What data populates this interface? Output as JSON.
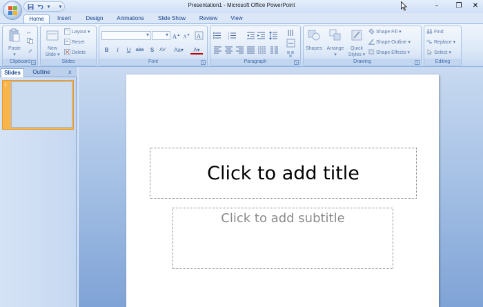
{
  "window": {
    "title": "Presentation1 - Microsoft Office PowerPoint",
    "controls": {
      "minimize": "–",
      "restore": "❐",
      "close": "✕"
    }
  },
  "quick_access": {
    "save_icon": "save-icon",
    "undo_icon": "undo-icon",
    "customize_icon": "customize-qat-icon"
  },
  "tabs": [
    {
      "label": "Home",
      "active": true
    },
    {
      "label": "Insert"
    },
    {
      "label": "Design"
    },
    {
      "label": "Animations"
    },
    {
      "label": "Slide Show"
    },
    {
      "label": "Review"
    },
    {
      "label": "View"
    }
  ],
  "ribbon": {
    "clipboard": {
      "label": "Clipboard",
      "paste": "Paste"
    },
    "slides": {
      "label": "Slides",
      "new_slide_line1": "New",
      "new_slide_line2": "Slide",
      "layout": "Layout",
      "reset": "Reset",
      "delete": "Delete"
    },
    "font": {
      "label": "Font",
      "bold": "B",
      "italic": "I",
      "underline": "U",
      "strike": "abe",
      "shadow": "S",
      "spacing": "AV",
      "case": "Aa",
      "color": "A",
      "grow": "A",
      "shrink": "A"
    },
    "paragraph": {
      "label": "Paragraph"
    },
    "drawing": {
      "label": "Drawing",
      "shapes": "Shapes",
      "arrange": "Arrange",
      "quick_styles_line1": "Quick",
      "quick_styles_line2": "Styles",
      "shape_fill": "Shape Fill",
      "shape_outline": "Shape Outline",
      "shape_effects": "Shape Effects"
    },
    "editing": {
      "label": "Editing",
      "find": "Find",
      "replace": "Replace",
      "select": "Select"
    }
  },
  "left_pane": {
    "tabs": [
      {
        "label": "Slides",
        "active": true
      },
      {
        "label": "Outline"
      }
    ],
    "close": "x",
    "slide_number": "1"
  },
  "slide": {
    "title_placeholder": "Click to add title",
    "subtitle_placeholder": "Click to add subtitle"
  },
  "colors": {
    "ribbon_bg": "#dde9f8",
    "tab_text": "#15428b",
    "thumb_highlight": "#f9b54b",
    "edit_bg_bottom": "#7fa3d6"
  }
}
